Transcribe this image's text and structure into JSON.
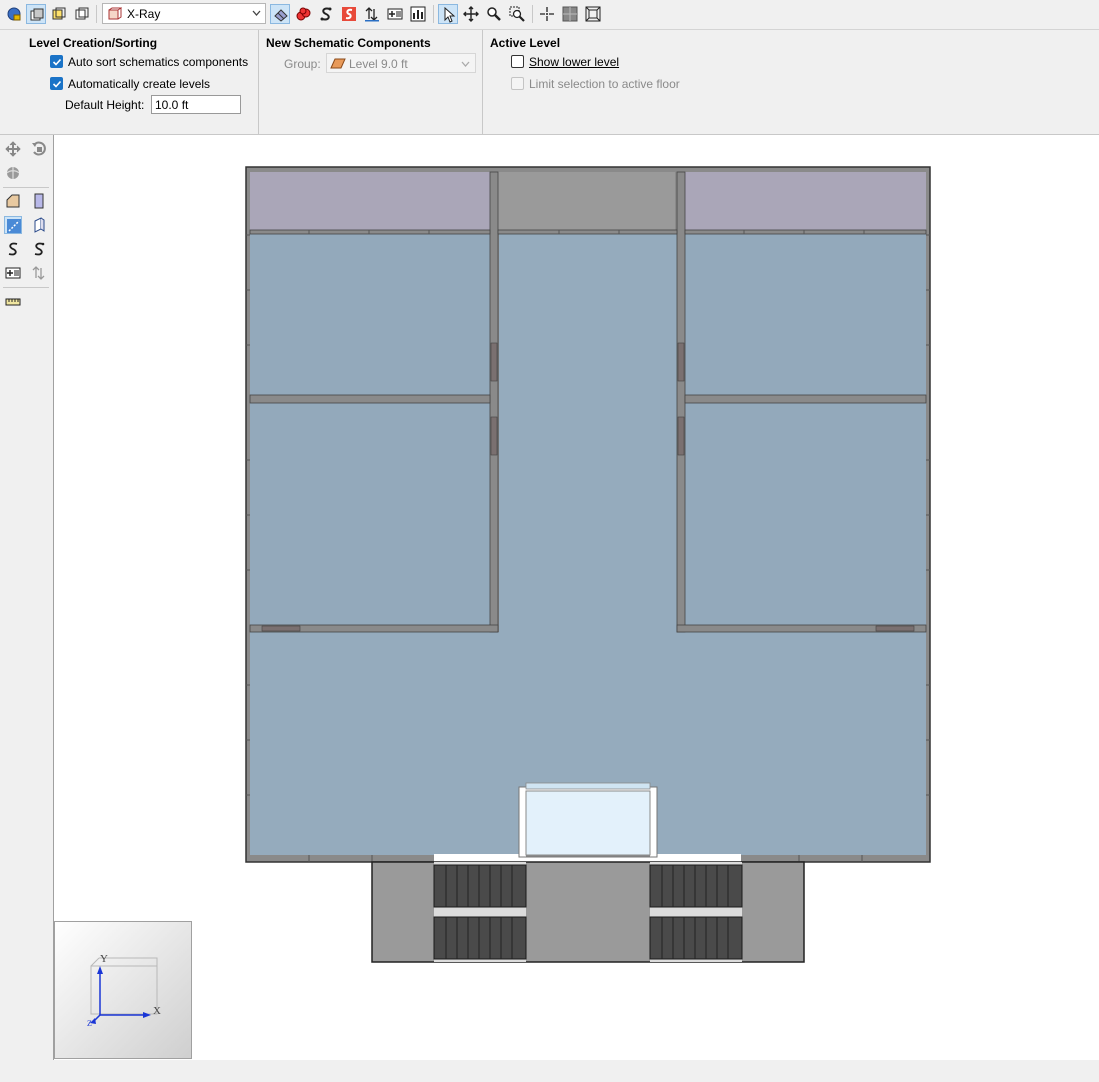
{
  "toolbar": {
    "view_mode_value": "X-Ray",
    "view_mode_icon": "xray-box-icon"
  },
  "ribbon": {
    "level_creation": {
      "title": "Level Creation/Sorting",
      "auto_sort_label": "Auto sort schematics components",
      "auto_sort_checked": true,
      "auto_create_label": "Automatically create levels",
      "auto_create_checked": true,
      "default_height_label": "Default Height:",
      "default_height_value": "10.0 ft"
    },
    "new_schematic": {
      "title": "New Schematic Components",
      "group_label": "Group:",
      "group_value": "Level 9.0 ft"
    },
    "active_level": {
      "title": "Active Level",
      "show_lower_label": "Show lower level",
      "show_lower_checked": false,
      "limit_selection_label": "Limit selection to active floor",
      "limit_selection_checked": false,
      "limit_selection_enabled": false
    }
  },
  "axes": {
    "x_label": "X",
    "y_label": "Y",
    "z_label": "Z"
  },
  "colors": {
    "room_fill": "#93a9bb",
    "porch_fill": "#aaa6b8",
    "wall": "#8a8a8a",
    "stair": "#4a4a4a",
    "selection_blue": "#1a73c7",
    "highlight_box": "#e3f1fb"
  }
}
